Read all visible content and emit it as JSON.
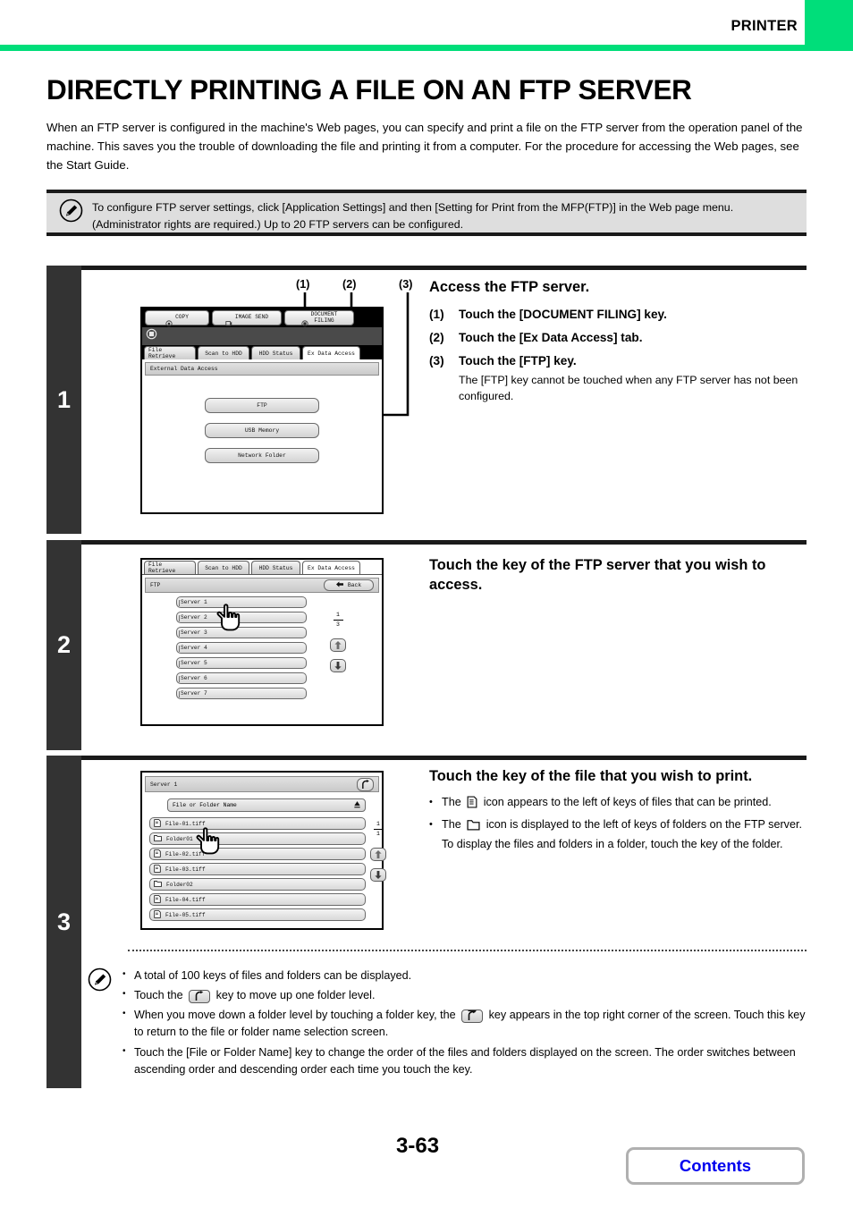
{
  "header": {
    "section_label": "PRINTER",
    "accent_color": "#00de7a"
  },
  "doc": {
    "title": "DIRECTLY PRINTING A FILE ON AN FTP SERVER",
    "intro": "When an FTP server is configured in the machine's Web pages, you can specify and print a file on the FTP server from the operation panel of the machine. This saves you the trouble of downloading the file and printing it from a computer. For the procedure for accessing the Web pages, see the Start Guide."
  },
  "info_note": {
    "icon": "pencil-note-icon",
    "text": "To configure FTP server settings, click [Application Settings] and then [Setting for Print from the MFP(FTP)] in the Web page menu. (Administrator rights are required.) Up to 20 FTP servers can be configured."
  },
  "steps": [
    {
      "number": "1",
      "heading": "Access the FTP server.",
      "substeps": [
        {
          "n": "(1)",
          "text": "Touch the [DOCUMENT FILING] key."
        },
        {
          "n": "(2)",
          "text": "Touch the [Ex Data Access] tab."
        },
        {
          "n": "(3)",
          "text": "Touch the [FTP] key.",
          "note": "The [FTP] key cannot be touched when any FTP server has not been configured."
        }
      ],
      "callouts": [
        "(1)",
        "(2)",
        "(3)"
      ],
      "screen": {
        "mode_keys": [
          "COPY",
          "IMAGE SEND",
          "DOCUMENT\nFILING"
        ],
        "tabs": [
          "File Retrieve",
          "Scan to HDD",
          "HDD Status",
          "Ex Data Access"
        ],
        "active_tab": "Ex Data Access",
        "title_bar": "External Data Access",
        "buttons": [
          "FTP",
          "USB Memory",
          "Network Folder"
        ]
      }
    },
    {
      "number": "2",
      "heading": "Touch the key of the FTP server that you wish to access.",
      "screen": {
        "tabs": [
          "File Retrieve",
          "Scan to HDD",
          "HDD Status",
          "Ex Data Access"
        ],
        "active_tab": "Ex Data Access",
        "title_bar": "FTP",
        "back_label": "Back",
        "servers": [
          "Server 1",
          "Server 2",
          "Server 3",
          "Server 4",
          "Server 5",
          "Server 6",
          "Server 7"
        ],
        "page_current": "1",
        "page_total": "3"
      }
    },
    {
      "number": "3",
      "heading": "Touch the key of the file that you wish to print.",
      "bullets": [
        {
          "pre": "The",
          "icon": "file-icon",
          "post": "icon appears to the left of keys of files that can be printed."
        },
        {
          "pre": "The",
          "icon": "folder-icon",
          "post": "icon is displayed to the left of keys of folders on the FTP server. To display the files and folders in a folder, touch the key of the folder."
        }
      ],
      "screen": {
        "title_bar": "Server 1",
        "up_key_icon": "return-up-icon",
        "sort_header": "File or Folder Name",
        "sort_direction_icon": "sort-ascending-icon",
        "entries": [
          {
            "name": "File-01.tiff",
            "type": "file"
          },
          {
            "name": "Folder01",
            "type": "folder"
          },
          {
            "name": "File-02.tiff",
            "type": "file"
          },
          {
            "name": "File-03.tiff",
            "type": "file"
          },
          {
            "name": "Folder02",
            "type": "folder"
          },
          {
            "name": "File-04.tiff",
            "type": "file"
          },
          {
            "name": "File-05.tiff",
            "type": "file"
          }
        ],
        "page_current": "1",
        "page_total": "1"
      }
    }
  ],
  "bottom_note": {
    "icon": "pencil-note-icon",
    "items": [
      {
        "pre": "A total of 100 keys of files and folders can be displayed.",
        "key": null,
        "post": ""
      },
      {
        "pre": "Touch the",
        "key": "return-up-icon",
        "post": "key to move up one folder level."
      },
      {
        "pre": "When you move down a folder level by touching a folder key, the",
        "key": "return-up-icon",
        "post": "key appears in the top right corner of the screen. Touch this key to return to the file or folder name selection screen."
      },
      {
        "pre": "Touch the [File or Folder Name] key to change the order of the files and folders displayed on the screen. The order switches between ascending order and descending order each time you touch the key.",
        "key": null,
        "post": ""
      }
    ]
  },
  "footer": {
    "page_number": "3-63",
    "contents_label": "Contents",
    "contents_color": "#0000ee"
  }
}
